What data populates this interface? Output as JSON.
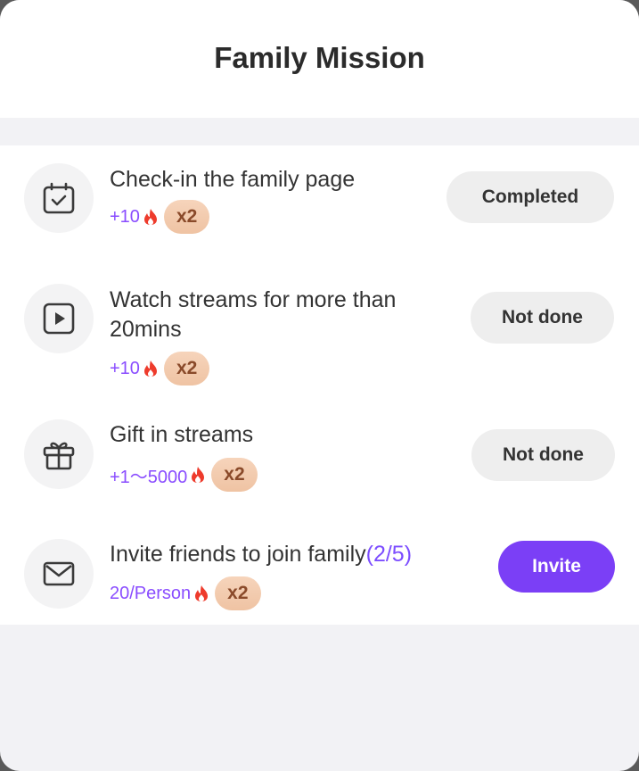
{
  "header": {
    "title": "Family Mission"
  },
  "missions": [
    {
      "title": "Check-in the family page",
      "reward": "+10",
      "multiplier": "x2",
      "button": "Completed",
      "icon": "calendar-check-icon"
    },
    {
      "title": "Watch streams for more than 20mins",
      "reward": "+10",
      "multiplier": "x2",
      "button": "Not done",
      "icon": "play-video-icon"
    },
    {
      "title": "Gift in streams",
      "reward": "+1～5000",
      "multiplier": "x2",
      "button": "Not done",
      "icon": "gift-icon"
    },
    {
      "title": "Invite friends to join family",
      "progress": "(2/5)",
      "reward": "20/Person",
      "multiplier": "x2",
      "button": "Invite",
      "icon": "envelope-icon"
    }
  ],
  "colors": {
    "accent": "#7b3ff6",
    "reward_text": "#8a4dff",
    "flame": "#ee3b2c",
    "multiplier_bg": "#f2c9ab"
  }
}
